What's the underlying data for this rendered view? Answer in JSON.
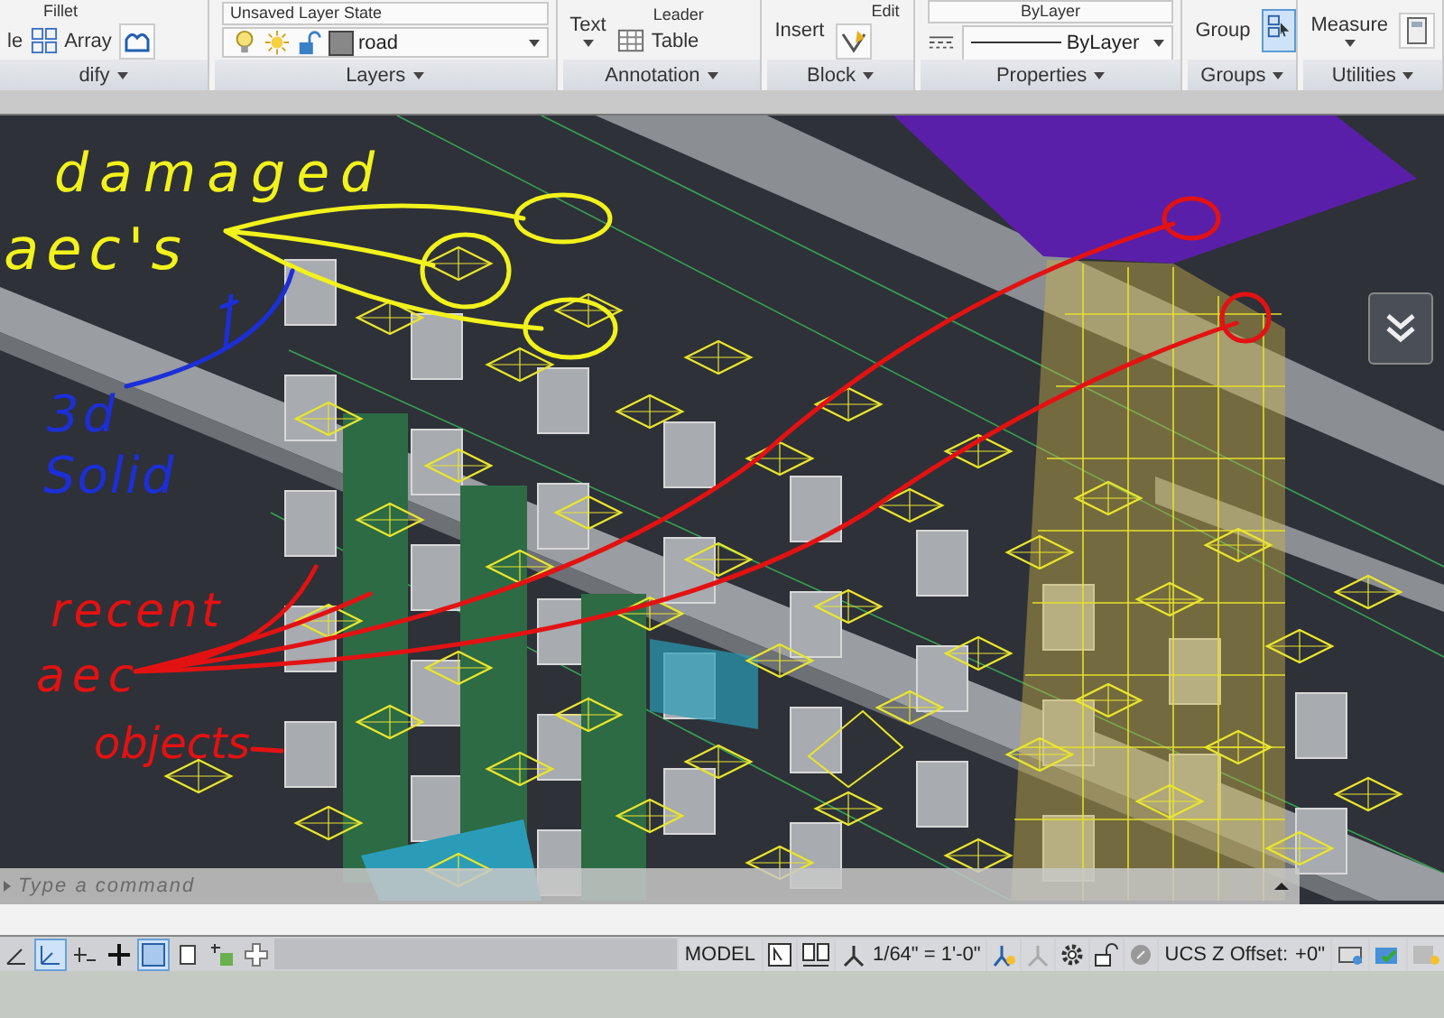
{
  "ribbon": {
    "panels": [
      {
        "kind": "modify",
        "label": "dify",
        "top": [
          "Fillet"
        ],
        "bottom": [
          "le",
          "Array"
        ]
      },
      {
        "kind": "layers",
        "label": "Layers",
        "state": "Unsaved Layer State",
        "layer": "road"
      },
      {
        "kind": "annotation",
        "label": "Annotation",
        "big": "Text",
        "top": [
          "Leader"
        ],
        "bottom": [
          "Table"
        ]
      },
      {
        "kind": "block",
        "label": "Block",
        "big": "Insert",
        "top": [
          "Edit"
        ]
      },
      {
        "kind": "properties",
        "label": "Properties",
        "top": "ByLayer",
        "bottom": "ByLayer"
      },
      {
        "kind": "groups",
        "label": "Groups",
        "big": "Group",
        "select_on": true
      },
      {
        "kind": "utilities",
        "label": "Utilities",
        "big": "Measure"
      }
    ]
  },
  "annotations": [
    {
      "text": "damaged",
      "color": "#f2f21c"
    },
    {
      "text": "aec's",
      "color": "#f2f21c"
    },
    {
      "text": "3d",
      "color": "#1c2fd6"
    },
    {
      "text": "Solid",
      "color": "#1c2fd6"
    },
    {
      "text": "recent",
      "color": "#e31212"
    },
    {
      "text": "aec",
      "color": "#e31212"
    },
    {
      "text": "objects",
      "color": "#e31212"
    }
  ],
  "command_line": {
    "placeholder": "Type a command"
  },
  "status_bar": {
    "toggles": [
      {
        "kind": "polar",
        "on": false
      },
      {
        "kind": "ucs",
        "on": true
      },
      {
        "kind": "snap",
        "on": false
      },
      {
        "kind": "ortho",
        "on": false
      },
      {
        "kind": "transparency",
        "on": true
      },
      {
        "kind": "calc",
        "on": false
      },
      {
        "kind": "add",
        "on": false
      },
      {
        "kind": "cross",
        "on": false
      }
    ],
    "model": "MODEL",
    "scale": "1/64\" = 1'-0\"",
    "ucs_label": "UCS Z Offset:",
    "ucs_value": "+0\""
  }
}
